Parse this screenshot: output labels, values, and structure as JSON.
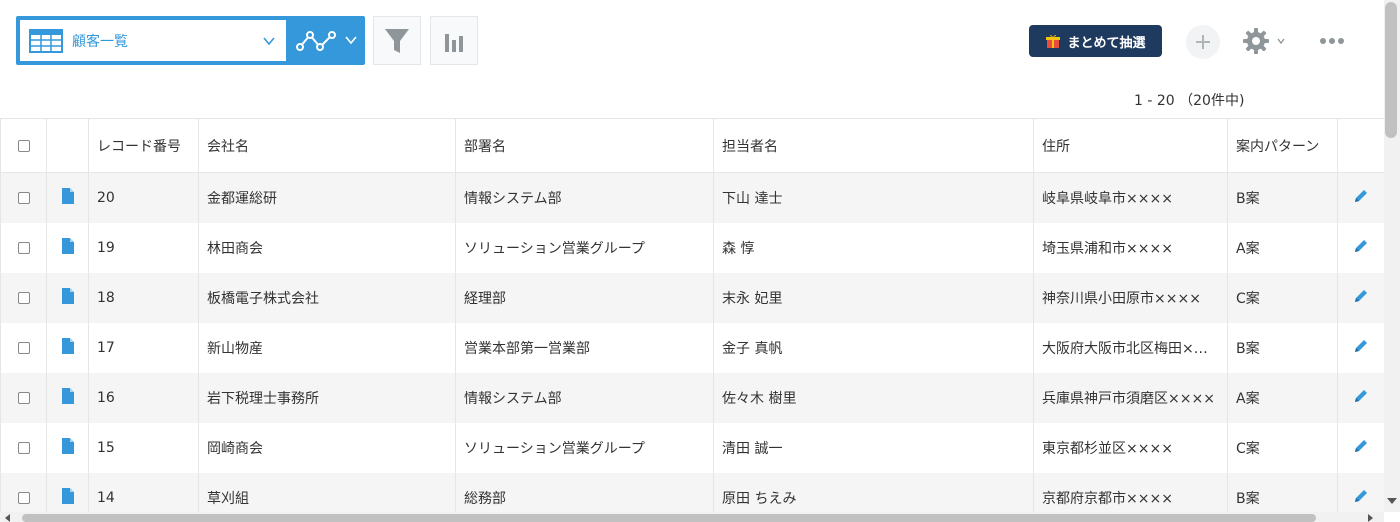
{
  "toolbar": {
    "view_name": "顧客一覧",
    "lottery_label": "まとめて抽選",
    "icons": [
      "table-icon",
      "chevron-down-icon",
      "graph-icon",
      "filter-icon",
      "bar-chart-icon",
      "gift-icon",
      "plus-icon",
      "gear-icon",
      "more-icon"
    ]
  },
  "pager": {
    "text": "1 - 20 （20件中)"
  },
  "table": {
    "headers": [
      "レコード番号",
      "会社名",
      "部署名",
      "担当者名",
      "住所",
      "案内パターン"
    ],
    "rows": [
      {
        "id": "20",
        "company": "金都運総研",
        "dept": "情報システム部",
        "person": "下山 達士",
        "address": "岐阜県岐阜市××××",
        "pattern": "B案"
      },
      {
        "id": "19",
        "company": "林田商会",
        "dept": "ソリューション営業グループ",
        "person": "森 惇",
        "address": "埼玉県浦和市××××",
        "pattern": "A案"
      },
      {
        "id": "18",
        "company": "板橋電子株式会社",
        "dept": "経理部",
        "person": "末永 妃里",
        "address": "神奈川県小田原市××××",
        "pattern": "C案"
      },
      {
        "id": "17",
        "company": "新山物産",
        "dept": "営業本部第一営業部",
        "person": "金子 真帆",
        "address": "大阪府大阪市北区梅田××××",
        "pattern": "B案"
      },
      {
        "id": "16",
        "company": "岩下税理士事務所",
        "dept": "情報システム部",
        "person": "佐々木 樹里",
        "address": "兵庫県神戸市須磨区××××",
        "pattern": "A案"
      },
      {
        "id": "15",
        "company": "岡崎商会",
        "dept": "ソリューション営業グループ",
        "person": "清田 誠一",
        "address": "東京都杉並区××××",
        "pattern": "C案"
      },
      {
        "id": "14",
        "company": "草刈組",
        "dept": "総務部",
        "person": "原田 ちえみ",
        "address": "京都府京都市××××",
        "pattern": "B案"
      }
    ]
  },
  "colors": {
    "accent": "#3498db",
    "button_dark": "#1e3a5f",
    "row_alt": "#f5f5f5",
    "border": "#e3e7e8"
  }
}
